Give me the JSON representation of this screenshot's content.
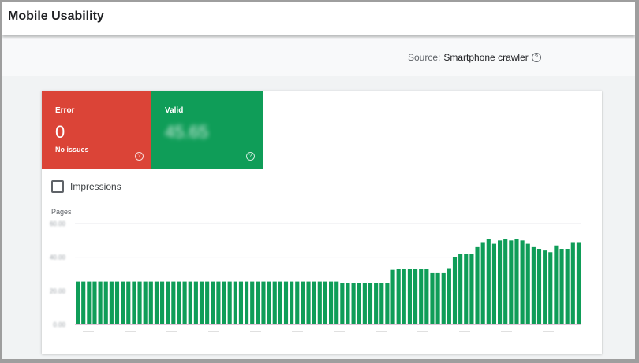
{
  "page": {
    "title": "Mobile Usability"
  },
  "source": {
    "label": "Source:",
    "value": "Smartphone crawler"
  },
  "tiles": [
    {
      "label": "Error",
      "count": "0",
      "subtitle": "No issues",
      "color": "#db4437"
    },
    {
      "label": "Valid",
      "count": "45.65",
      "subtitle": "",
      "color": "#0f9d58"
    }
  ],
  "impressions": {
    "label": "Impressions",
    "checked": false
  },
  "chart_data": {
    "type": "bar",
    "ylabel": "Pages",
    "color": "#0f9d58",
    "ylim": [
      0,
      60
    ],
    "yticks": [
      0,
      20,
      40,
      60
    ],
    "ytick_labels": [
      "0.00",
      "20.00",
      "40.00",
      "60.00"
    ],
    "values": [
      25.5,
      25.5,
      25.5,
      25.5,
      25.5,
      25.5,
      25.5,
      25.5,
      25.5,
      25.5,
      25.5,
      25.5,
      25.5,
      25.5,
      25.5,
      25.5,
      25.5,
      25.5,
      25.5,
      25.5,
      25.5,
      25.5,
      25.5,
      25.5,
      25.5,
      25.5,
      25.5,
      25.5,
      25.5,
      25.5,
      25.5,
      25.5,
      25.5,
      25.5,
      25.5,
      25.5,
      25.5,
      25.5,
      25.5,
      25.5,
      25.5,
      25.5,
      25.5,
      25.5,
      25.5,
      25.5,
      25.5,
      24.5,
      24.5,
      24.5,
      24.5,
      24.5,
      24.5,
      24.5,
      24.5,
      24.5,
      32.5,
      33,
      33,
      33,
      33,
      33,
      33,
      30.5,
      30.5,
      30.5,
      33.5,
      40,
      42,
      42,
      42,
      46,
      49,
      51,
      48,
      50,
      51,
      50,
      51,
      50,
      48,
      46,
      45,
      44,
      43,
      47,
      45,
      45,
      49,
      49
    ]
  }
}
